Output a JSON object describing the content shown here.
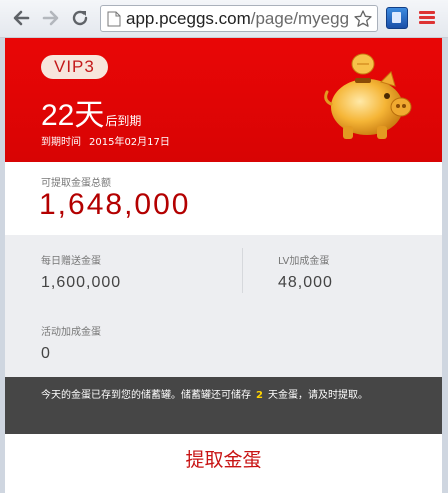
{
  "browser": {
    "url_host": "app.pceggs.com",
    "url_path": "/page/myegg"
  },
  "hero": {
    "vip_label": "VIP3",
    "days_value": "22天",
    "days_suffix": "后到期",
    "expiry_label": "到期时间",
    "expiry_date": "2015年02月17日"
  },
  "withdrawable": {
    "label": "可提取金蛋总额",
    "value": "1,648,000"
  },
  "stats": {
    "daily_gift": {
      "label": "每日赠送金蛋",
      "value": "1,600,000"
    },
    "lv_bonus": {
      "label": "LV加成金蛋",
      "value": "48,000"
    },
    "activity_bonus": {
      "label": "活动加成金蛋",
      "value": "0"
    }
  },
  "notice": {
    "text_before": "今天的金蛋已存到您的储蓄罐。储蓄罐还可储存",
    "highlight": "2",
    "text_after": "天金蛋，请及时提取。"
  },
  "actions": {
    "withdraw_label": "提取金蛋"
  },
  "colors": {
    "brand_red": "#e10505",
    "value_red": "#b30000",
    "notice_bg": "#464646",
    "highlight_yellow": "#ffd400"
  }
}
